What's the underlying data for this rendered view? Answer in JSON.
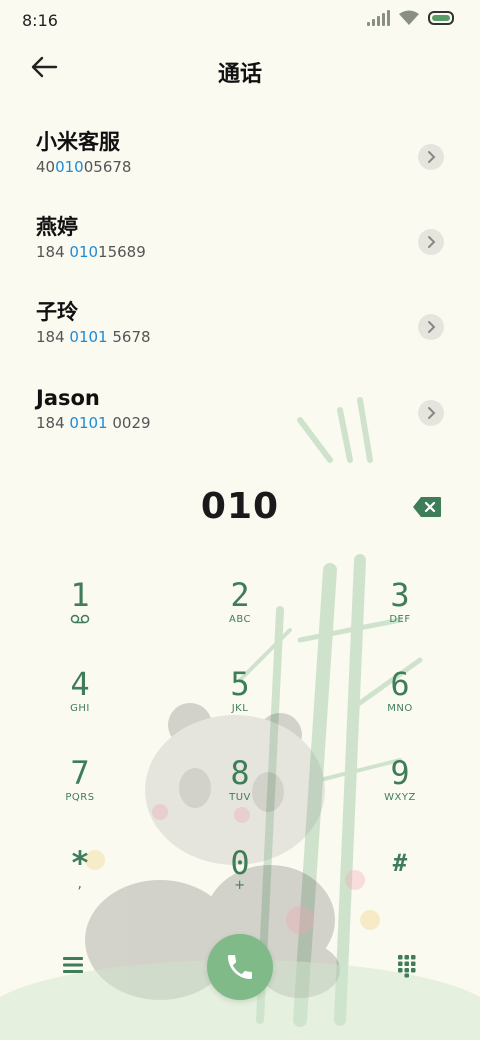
{
  "status": {
    "time": "8:16"
  },
  "header": {
    "title": "通话"
  },
  "contacts": [
    {
      "name": "小米客服",
      "number_pre": "40",
      "number_hl": "010",
      "number_post": "05678"
    },
    {
      "name": "燕婷",
      "number_pre": "184 ",
      "number_hl": "010",
      "number_post": "15689"
    },
    {
      "name": "子玲",
      "number_pre": "184 ",
      "number_hl": "0101",
      "number_post": " 5678"
    },
    {
      "name": "Jason",
      "number_pre": "184 ",
      "number_hl": "0101",
      "number_post": " 0029"
    }
  ],
  "dialer": {
    "value": "010",
    "keys": [
      {
        "digit": "1",
        "sub": "voicemail-icon"
      },
      {
        "digit": "2",
        "sub": "ABC"
      },
      {
        "digit": "3",
        "sub": "DEF"
      },
      {
        "digit": "4",
        "sub": "GHI"
      },
      {
        "digit": "5",
        "sub": "JKL"
      },
      {
        "digit": "6",
        "sub": "MNO"
      },
      {
        "digit": "7",
        "sub": "PQRS"
      },
      {
        "digit": "8",
        "sub": "TUV"
      },
      {
        "digit": "9",
        "sub": "WXYZ"
      },
      {
        "digit": "*",
        "sub": ","
      },
      {
        "digit": "0",
        "sub": "+"
      },
      {
        "digit": "#",
        "sub": ""
      }
    ]
  },
  "colors": {
    "accent_green": "#3f7d59",
    "call_button": "#7fba88",
    "highlight_blue": "#1c8bd6",
    "background": "#fbfaf1"
  }
}
